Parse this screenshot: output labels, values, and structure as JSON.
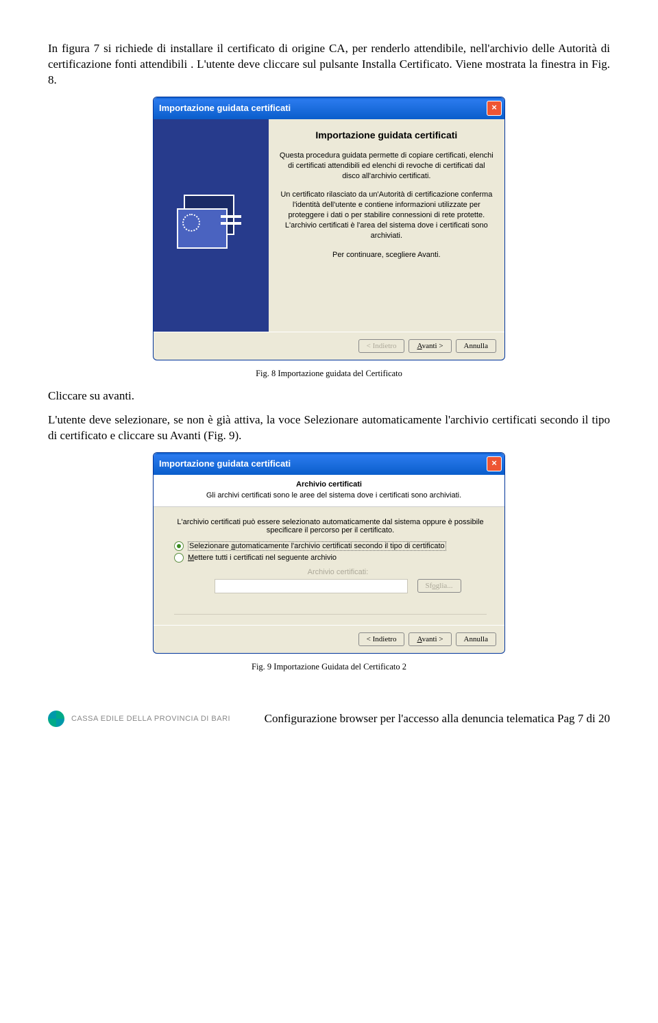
{
  "para1": "In figura 7 si richiede di installare il certificato di origine CA, per renderlo attendibile, nell'archivio delle Autorità di certificazione fonti attendibili . L'utente deve cliccare sul pulsante Installa Certificato. Viene mostrata la finestra in Fig. 8.",
  "dlg1": {
    "title": "Importazione guidata certificati",
    "h": "Importazione guidata certificati",
    "p1": "Questa procedura guidata permette di copiare certificati, elenchi di certificati attendibili ed elenchi di revoche di certificati dal disco all'archivio certificati.",
    "p2": "Un certificato rilasciato da un'Autorità di certificazione conferma l'identità dell'utente e contiene informazioni utilizzate per proteggere i dati o per stabilire connessioni di rete protette. L'archivio certificati è l'area del sistema dove i certificati sono archiviati.",
    "p3": "Per continuare, scegliere Avanti.",
    "back": "< Indietro",
    "next": "Avanti >",
    "cancel": "Annulla"
  },
  "caption1": "Fig. 8 Importazione guidata del Certificato",
  "para2": "Cliccare su avanti.",
  "para3": "L'utente deve selezionare, se non è già attiva, la voce Selezionare automaticamente l'archivio certificati secondo il tipo di certificato e cliccare su Avanti (Fig. 9).",
  "dlg2": {
    "title": "Importazione guidata certificati",
    "header": "Archivio certificati",
    "sub": "Gli archivi certificati sono le aree del sistema dove i certificati sono archiviati.",
    "lead": "L'archivio certificati può essere selezionato automaticamente dal sistema oppure è possibile specificare il percorso per il certificato.",
    "r1": "Selezionare automaticamente l'archivio certificati secondo il tipo di certificato",
    "r2": "Mettere tutti i certificati nel seguente archivio",
    "label": "Archivio certificati:",
    "browse": "Sfoglia...",
    "back": "< Indietro",
    "next": "Avanti >",
    "cancel": "Annulla"
  },
  "caption2": "Fig. 9 Importazione Guidata del Certificato 2",
  "footer_brand": "CASSA EDILE DELLA PROVINCIA DI BARI",
  "footer_page": "Configurazione browser per l'accesso alla denuncia telematica Pag 7 di 20"
}
